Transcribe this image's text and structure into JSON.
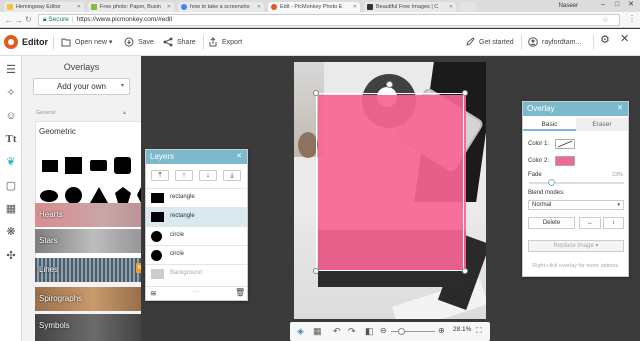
{
  "browser": {
    "tabs": [
      {
        "label": "Hemingway Editor",
        "color": "#f0c24b"
      },
      {
        "label": "Free photo: Paper, Busin",
        "color": "#7fbf3f"
      },
      {
        "label": "how to take a screensho",
        "color": "#4285f4"
      },
      {
        "label": "Edit - PicMonkey Photo E",
        "color": "#e05a24"
      },
      {
        "label": "Beautiful Free Images | C",
        "color": "#333333"
      }
    ],
    "username": "Naseer",
    "url_secure": "Secure",
    "url": "https://www.picmonkey.com/#edit"
  },
  "header": {
    "editor": "Editor",
    "open_new": "Open new",
    "save": "Save",
    "share": "Share",
    "export": "Export",
    "get_started": "Get started",
    "account": "rayfordtam..."
  },
  "overlays_panel": {
    "title": "Overlays",
    "add_your_own": "Add your own",
    "section": "General",
    "geometric": "Geometric",
    "categories": [
      {
        "label": "Hearts"
      },
      {
        "label": "Stars"
      },
      {
        "label": "Lines",
        "badge": "New"
      },
      {
        "label": "Spirographs"
      },
      {
        "label": "Symbols"
      }
    ]
  },
  "layers_panel": {
    "title": "Layers",
    "rows": [
      {
        "name": "rectangle"
      },
      {
        "name": "rectangle"
      },
      {
        "name": "circle"
      },
      {
        "name": "circle"
      },
      {
        "name": "Background"
      }
    ]
  },
  "overlay_panel": {
    "title": "Overlay",
    "tab_basic": "Basic",
    "tab_eraser": "Eraser",
    "color1": "Color 1:",
    "color2": "Color 2:",
    "color2_value": "#f06a99",
    "fade": "Fade",
    "fade_value": "23%",
    "fade_fraction": 0.23,
    "blend_label": "Blend modes:",
    "blend_value": "Normal",
    "delete": "Delete",
    "replace": "Replace image",
    "hint": "Right-click overlay for more options."
  },
  "canvas": {
    "zoom": "28.1%",
    "overlay_color": "#f76595"
  }
}
